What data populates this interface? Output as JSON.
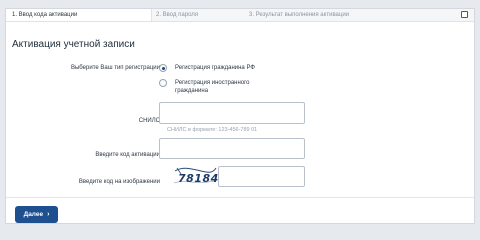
{
  "tabs": [
    {
      "label": "1. Ввод кода активации",
      "active": true
    },
    {
      "label": "2. Ввод пароля",
      "active": false
    },
    {
      "label": "3. Результат выполнения активации",
      "active": false
    }
  ],
  "page_title": "Активация учетной записи",
  "registration_type": {
    "label": "Выберите Ваш тип регистрации",
    "options": [
      {
        "label": "Регистрация гражданина РФ",
        "selected": true
      },
      {
        "label": "Регистрация иностранного гражданина",
        "selected": false
      }
    ]
  },
  "snils": {
    "label": "СНИЛС",
    "value": "",
    "hint": "СНИЛС в формате: 123-456-789 01"
  },
  "activation_code": {
    "label": "Введите код активации",
    "value": ""
  },
  "captcha": {
    "label": "Введите код на изображении",
    "image_text": "78184",
    "value": ""
  },
  "next_button": {
    "label": "Далее",
    "icon": "chevron-right-icon"
  },
  "colors": {
    "accent": "#1e4f8e",
    "background": "#e6e9ed"
  }
}
